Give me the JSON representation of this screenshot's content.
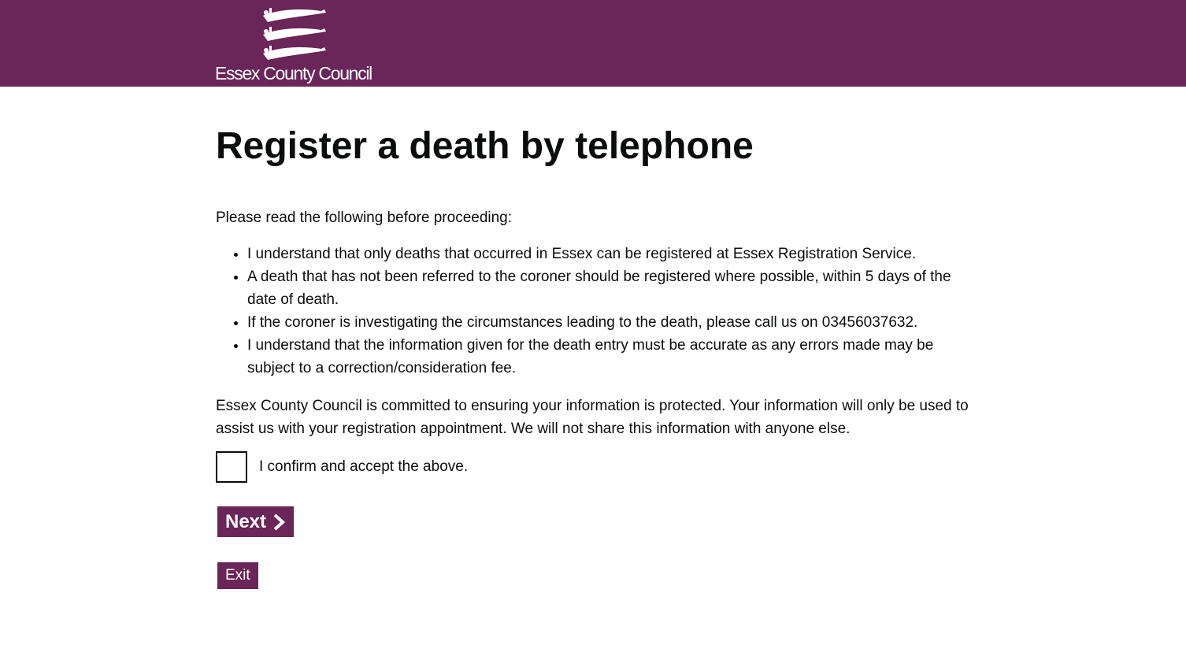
{
  "header": {
    "logo_text": "Essex County Council",
    "logo_icon": "three-seaxes-crest-icon",
    "background_color": "#6a2559"
  },
  "main": {
    "title": "Register a death by telephone",
    "intro": "Please read the following before proceeding:",
    "conditions": [
      "I understand that only deaths that occurred in Essex can be registered at Essex Registration Service.",
      "A death that has not been referred to the coroner should be registered where possible, within 5 days of the date of death.",
      "If the coroner is investigating the circumstances leading to the death, please call us on 03456037632.",
      "I understand that the information given for the death entry must be accurate as any errors made may be subject to a correction/consideration fee."
    ],
    "privacy": "Essex County Council is committed to ensuring your information is protected. Your information will only be used to assist us with your registration appointment. We will not share this information with anyone else.",
    "confirm_label": "I confirm and accept the above.",
    "confirm_checked": false,
    "next_label": "Next",
    "next_icon": "chevron-right-icon",
    "exit_label": "Exit",
    "accent_color": "#6a2559"
  }
}
